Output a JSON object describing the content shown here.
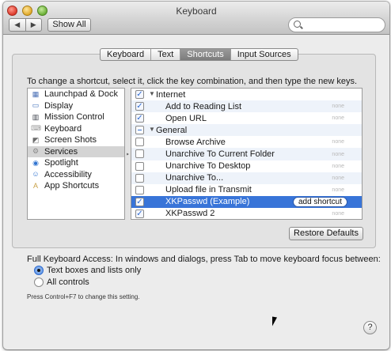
{
  "window": {
    "title": "Keyboard"
  },
  "toolbar": {
    "back": "◀",
    "forward": "▶",
    "show_all": "Show All",
    "search_placeholder": ""
  },
  "tabs": [
    {
      "label": "Keyboard",
      "active": false
    },
    {
      "label": "Text",
      "active": false
    },
    {
      "label": "Shortcuts",
      "active": true
    },
    {
      "label": "Input Sources",
      "active": false
    }
  ],
  "instruction": "To change a shortcut, select it, click the key combination, and then type the new keys.",
  "categories": [
    {
      "label": "Launchpad & Dock",
      "icon": "launchpad-icon",
      "color": "#4a6fb5",
      "selected": false
    },
    {
      "label": "Display",
      "icon": "display-icon",
      "color": "#3b6db8",
      "selected": false
    },
    {
      "label": "Mission Control",
      "icon": "mission-control-icon",
      "color": "#3a3f4a",
      "selected": false
    },
    {
      "label": "Keyboard",
      "icon": "keyboard-icon",
      "color": "#9a9a9a",
      "selected": false
    },
    {
      "label": "Screen Shots",
      "icon": "screenshot-icon",
      "color": "#6b6b6b",
      "selected": false
    },
    {
      "label": "Services",
      "icon": "gear-icon",
      "color": "#8a8a8a",
      "selected": true
    },
    {
      "label": "Spotlight",
      "icon": "spotlight-icon",
      "color": "#2f73d0",
      "selected": false
    },
    {
      "label": "Accessibility",
      "icon": "accessibility-icon",
      "color": "#2f73d0",
      "selected": false
    },
    {
      "label": "App Shortcuts",
      "icon": "app-shortcuts-icon",
      "color": "#c9a24a",
      "selected": false
    }
  ],
  "shortcuts": [
    {
      "type": "group",
      "label": "Internet",
      "check": "checked",
      "value": ""
    },
    {
      "type": "item",
      "label": "Add to Reading List",
      "check": "checked",
      "value": "none"
    },
    {
      "type": "item",
      "label": "Open URL",
      "check": "checked",
      "value": "none"
    },
    {
      "type": "group",
      "label": "General",
      "check": "mixed",
      "value": ""
    },
    {
      "type": "item",
      "label": "Browse Archive",
      "check": "unchecked",
      "value": "none"
    },
    {
      "type": "item",
      "label": "Unarchive To Current Folder",
      "check": "unchecked",
      "value": "none"
    },
    {
      "type": "item",
      "label": "Unarchive To Desktop",
      "check": "unchecked",
      "value": "none"
    },
    {
      "type": "item",
      "label": "Unarchive To...",
      "check": "unchecked",
      "value": "none"
    },
    {
      "type": "item",
      "label": "Upload file in Transmit",
      "check": "unchecked",
      "value": "none"
    },
    {
      "type": "item",
      "label": "XKPasswd (Example)",
      "check": "checked",
      "value": "add shortcut",
      "selected": true
    },
    {
      "type": "item",
      "label": "XKPasswd 2",
      "check": "checked",
      "value": "none"
    }
  ],
  "restore_defaults": "Restore Defaults",
  "full_keyboard_access": {
    "label": "Full Keyboard Access: In windows and dialogs, press Tab to move keyboard focus between:",
    "options": [
      {
        "label": "Text boxes and lists only",
        "selected": true
      },
      {
        "label": "All controls",
        "selected": false
      }
    ],
    "hint": "Press Control+F7 to change this setting."
  },
  "help": "?"
}
